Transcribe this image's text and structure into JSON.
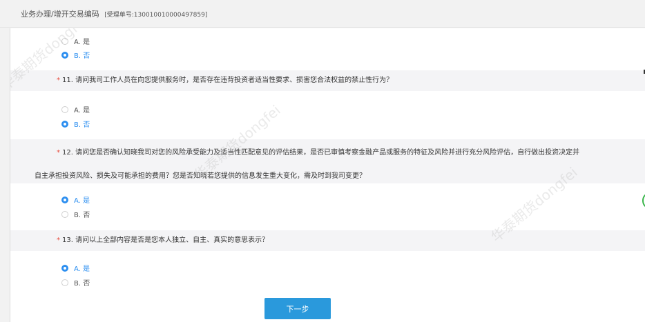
{
  "header": {
    "breadcrumb": "业务办理/增开交易编码",
    "receipt_code": "[受理单号:130010010000497859]"
  },
  "questions": [
    {
      "number": "",
      "text": "",
      "options": [
        {
          "label": "A. 是",
          "selected": false
        },
        {
          "label": "B. 否",
          "selected": true
        }
      ]
    },
    {
      "number": "11.",
      "text": "请问我司工作人员在向您提供服务时，是否存在违背投资者适当性要求、损害您合法权益的禁止性行为？",
      "options": [
        {
          "label": "A. 是",
          "selected": false
        },
        {
          "label": "B. 否",
          "selected": true
        }
      ]
    },
    {
      "number": "12.",
      "text": "请问您是否确认知晓我司对您的风险承受能力及适当性匹配意见的评估结果，是否已审慎考察金融产品或服务的特征及风险并进行充分风险评估，自行做出投资决定并",
      "text_cont": "自主承担投资风险、损失及可能承担的费用？您是否知晓若您提供的信息发生重大变化，需及时到我司变更？",
      "options": [
        {
          "label": "A. 是",
          "selected": true
        },
        {
          "label": "B. 否",
          "selected": false
        }
      ]
    },
    {
      "number": "13.",
      "text": "请问以上全部内容是否是您本人独立、自主、真实的意思表示？",
      "options": [
        {
          "label": "A. 是",
          "selected": true
        },
        {
          "label": "B. 否",
          "selected": false
        }
      ]
    }
  ],
  "required_mark": "*",
  "next_label": "下一步",
  "watermark": "华泰期货dongfei",
  "colors": {
    "accent": "#2d8ff0",
    "button": "#2a99dc",
    "required": "#e84b3c"
  }
}
